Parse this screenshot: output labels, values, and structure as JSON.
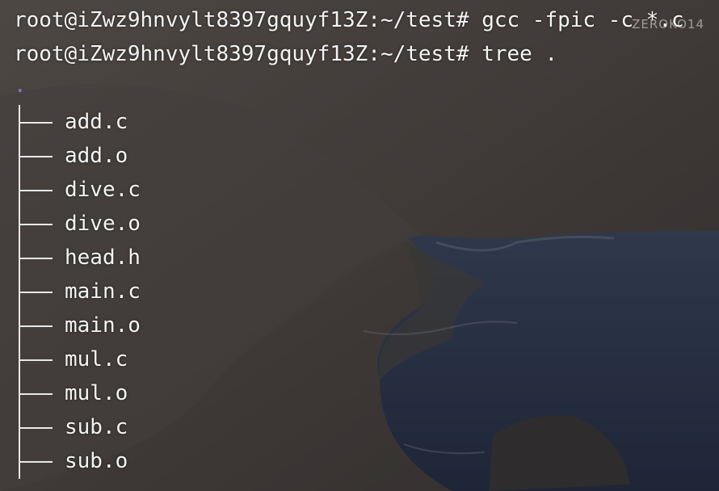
{
  "terminal": {
    "lines": [
      {
        "prompt": "root@iZwz9hnvylt8397gquyf13Z:~/test#",
        "command": "gcc -fpic -c *.c"
      },
      {
        "prompt": "root@iZwz9hnvylt8397gquyf13Z:~/test#",
        "command": "tree ."
      }
    ],
    "tree_root": ".",
    "files": [
      "add.c",
      "add.o",
      "dive.c",
      "dive.o",
      "head.h",
      "main.c",
      "main.o",
      "mul.c",
      "mul.o",
      "sub.c",
      "sub.o"
    ]
  },
  "watermark": "ZEROKO14",
  "colors": {
    "text": "#f4f4f4",
    "tree_root": "#8a78c8",
    "sea": "#2b3a5a",
    "rock": "#5a524c"
  }
}
